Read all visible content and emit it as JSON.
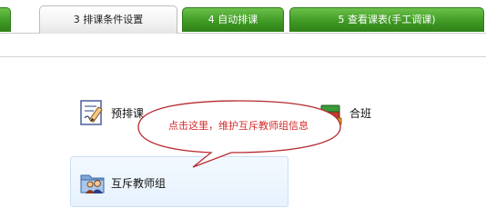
{
  "tabs": [
    {
      "label": ""
    },
    {
      "label": "3 排课条件设置"
    },
    {
      "label": "4 自动排课"
    },
    {
      "label": "5 查看课表(手工调课)"
    }
  ],
  "items": {
    "pre_schedule": {
      "label": "预排课",
      "icon": "pen-paper-icon"
    },
    "merge_class": {
      "label": "合班",
      "icon": "books-icon"
    },
    "mutex_teacher_group": {
      "label": "互斥教师组",
      "icon": "folder-people-icon"
    }
  },
  "callout": {
    "text": "点击这里，维护互斥教师组信息",
    "color": "#d52a2a"
  },
  "colors": {
    "tab_green": "#3f9a24",
    "panel_bg": "#eaf4fe"
  }
}
